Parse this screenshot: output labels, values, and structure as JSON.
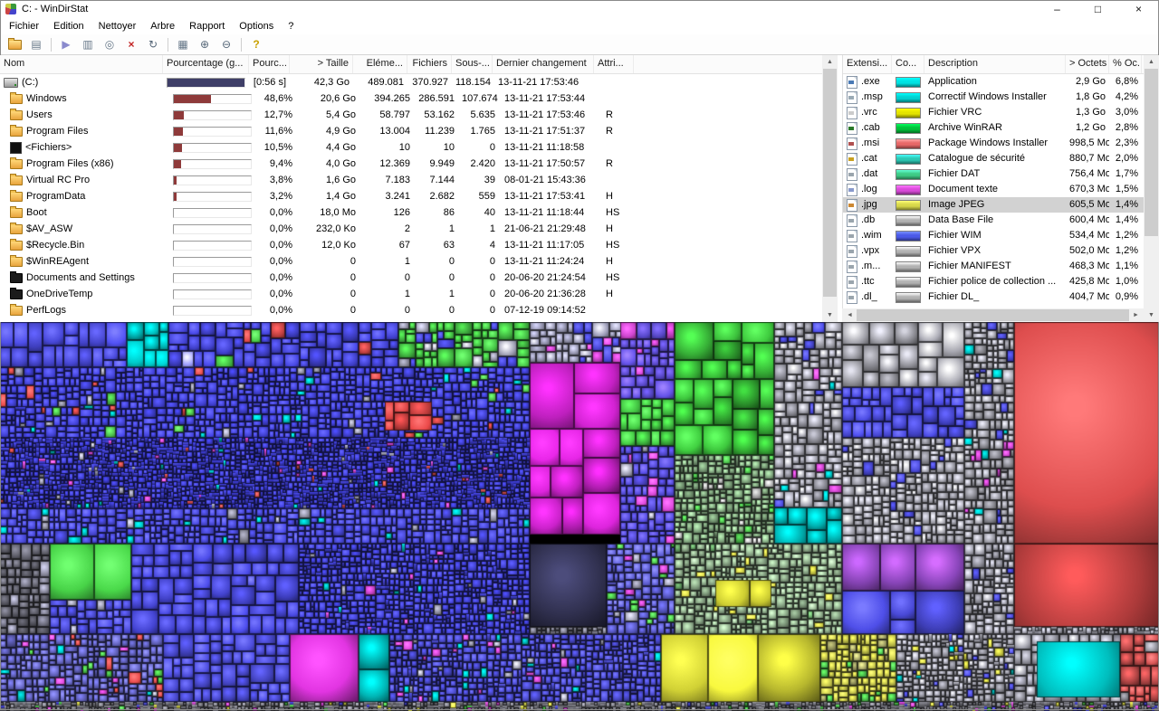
{
  "window": {
    "title": "C: - WinDirStat",
    "controls": [
      {
        "name": "minimize-button",
        "glyph": "–"
      },
      {
        "name": "maximize-button",
        "glyph": "□"
      },
      {
        "name": "close-button",
        "glyph": "×"
      }
    ]
  },
  "menu": {
    "items": [
      "Fichier",
      "Edition",
      "Nettoyer",
      "Arbre",
      "Rapport",
      "Options",
      "?"
    ]
  },
  "toolbar": {
    "buttons": [
      {
        "name": "open-folder-icon",
        "type": "folder"
      },
      {
        "name": "file-tree-icon",
        "glyph": "▤",
        "color": "#667788"
      },
      {
        "sep": true
      },
      {
        "name": "play-icon",
        "glyph": "▶",
        "color": "#8a8acd"
      },
      {
        "name": "copy-icon",
        "glyph": "▥",
        "color": "#667788"
      },
      {
        "name": "zoom-icon",
        "glyph": "◎",
        "color": "#667788"
      },
      {
        "name": "delete-icon",
        "glyph": "×",
        "color": "#c22222"
      },
      {
        "name": "refresh-icon",
        "glyph": "↻",
        "color": "#556677"
      },
      {
        "sep": true
      },
      {
        "name": "report-icon",
        "glyph": "▦",
        "color": "#667788"
      },
      {
        "name": "zoom-in-icon",
        "glyph": "⊕",
        "color": "#556677"
      },
      {
        "name": "zoom-out-icon",
        "glyph": "⊖",
        "color": "#556677"
      },
      {
        "sep": true
      },
      {
        "name": "help-icon",
        "glyph": "?",
        "color": "#c9a100"
      }
    ]
  },
  "tree": {
    "columns": [
      "Nom",
      "Pourcentage (g...",
      "Pourc...",
      "> Taille",
      "Eléme...",
      "Fichiers",
      "Sous-...",
      "Dernier changement",
      "Attri..."
    ],
    "bar_color": "#8e3a3a",
    "rows": [
      {
        "name": "(C:)",
        "icon": "drive",
        "bar": 100,
        "bar_color": "#3f3f68",
        "pct": "[0:56 s]",
        "size": "42,3 Go",
        "items": "489.081",
        "files": "370.927",
        "subdirs": "118.154",
        "changed": "13-11-21 17:53:46",
        "attr": ""
      },
      {
        "name": "Windows",
        "icon": "folder",
        "bar": 48.6,
        "pct": "48,6%",
        "size": "20,6 Go",
        "items": "394.265",
        "files": "286.591",
        "subdirs": "107.674",
        "changed": "13-11-21 17:53:44",
        "attr": ""
      },
      {
        "name": "Users",
        "icon": "folder",
        "bar": 12.7,
        "pct": "12,7%",
        "size": "5,4 Go",
        "items": "58.797",
        "files": "53.162",
        "subdirs": "5.635",
        "changed": "13-11-21 17:53:46",
        "attr": "R"
      },
      {
        "name": "Program Files",
        "icon": "folder",
        "bar": 11.6,
        "pct": "11,6%",
        "size": "4,9 Go",
        "items": "13.004",
        "files": "11.239",
        "subdirs": "1.765",
        "changed": "13-11-21 17:51:37",
        "attr": "R"
      },
      {
        "name": "<Fichiers>",
        "icon": "files",
        "bar": 10.5,
        "pct": "10,5%",
        "size": "4,4 Go",
        "items": "10",
        "files": "10",
        "subdirs": "0",
        "changed": "13-11-21 11:18:58",
        "attr": ""
      },
      {
        "name": "Program Files (x86)",
        "icon": "folder",
        "bar": 9.4,
        "pct": "9,4%",
        "size": "4,0 Go",
        "items": "12.369",
        "files": "9.949",
        "subdirs": "2.420",
        "changed": "13-11-21 17:50:57",
        "attr": "R"
      },
      {
        "name": "Virtual RC Pro",
        "icon": "folder",
        "bar": 3.8,
        "pct": "3,8%",
        "size": "1,6 Go",
        "items": "7.183",
        "files": "7.144",
        "subdirs": "39",
        "changed": "08-01-21 15:43:36",
        "attr": ""
      },
      {
        "name": "ProgramData",
        "icon": "folder",
        "bar": 3.2,
        "pct": "3,2%",
        "size": "1,4 Go",
        "items": "3.241",
        "files": "2.682",
        "subdirs": "559",
        "changed": "13-11-21 17:53:41",
        "attr": "H"
      },
      {
        "name": "Boot",
        "icon": "folder",
        "bar": 0,
        "pct": "0,0%",
        "size": "18,0 Mo",
        "items": "126",
        "files": "86",
        "subdirs": "40",
        "changed": "13-11-21 11:18:44",
        "attr": "HS"
      },
      {
        "name": "$AV_ASW",
        "icon": "folder",
        "bar": 0,
        "pct": "0,0%",
        "size": "232,0 Ko",
        "items": "2",
        "files": "1",
        "subdirs": "1",
        "changed": "21-06-21 21:29:48",
        "attr": "H"
      },
      {
        "name": "$Recycle.Bin",
        "icon": "folder",
        "bar": 0,
        "pct": "0,0%",
        "size": "12,0 Ko",
        "items": "67",
        "files": "63",
        "subdirs": "4",
        "changed": "13-11-21 11:17:05",
        "attr": "HS"
      },
      {
        "name": "$WinREAgent",
        "icon": "folder",
        "bar": 0,
        "pct": "0,0%",
        "size": "0",
        "items": "1",
        "files": "0",
        "subdirs": "0",
        "changed": "13-11-21 11:24:24",
        "attr": "H"
      },
      {
        "name": "Documents and Settings",
        "icon": "folder-dark",
        "bar": 0,
        "pct": "0,0%",
        "size": "0",
        "items": "0",
        "files": "0",
        "subdirs": "0",
        "changed": "20-06-20 21:24:54",
        "attr": "HS"
      },
      {
        "name": "OneDriveTemp",
        "icon": "folder-dark",
        "bar": 0,
        "pct": "0,0%",
        "size": "0",
        "items": "1",
        "files": "1",
        "subdirs": "0",
        "changed": "20-06-20 21:36:28",
        "attr": "H"
      },
      {
        "name": "PerfLogs",
        "icon": "folder",
        "bar": 0,
        "pct": "0,0%",
        "size": "0",
        "items": "0",
        "files": "0",
        "subdirs": "0",
        "changed": "07-12-19 09:14:52",
        "attr": ""
      }
    ]
  },
  "extensions": {
    "columns": [
      "Extensi...",
      "Co...",
      "Description",
      "> Octets",
      "% Oc..."
    ],
    "rows": [
      {
        "ext": ".exe",
        "color": "#00e2e2",
        "icon_accent": "#4a7ab5",
        "desc": "Application",
        "bytes": "2,9 Go",
        "pct": "6,8%"
      },
      {
        "ext": ".msp",
        "color": "#00d2d2",
        "icon_accent": "#9aaab5",
        "desc": "Correctif Windows Installer",
        "bytes": "1,8 Go",
        "pct": "4,2%"
      },
      {
        "ext": ".vrc",
        "color": "#e4e400",
        "icon_accent": "#cccccc",
        "desc": "Fichier VRC",
        "bytes": "1,3 Go",
        "pct": "3,0%"
      },
      {
        "ext": ".cab",
        "color": "#00c23a",
        "icon_accent": "#2a7a2a",
        "desc": "Archive WinRAR",
        "bytes": "1,2 Go",
        "pct": "2,8%"
      },
      {
        "ext": ".msi",
        "color": "#e86868",
        "icon_accent": "#b05050",
        "desc": "Package Windows Installer",
        "bytes": "998,5 Mo",
        "pct": "2,3%"
      },
      {
        "ext": ".cat",
        "color": "#2cc8b4",
        "icon_accent": "#c8a020",
        "desc": "Catalogue de sécurité",
        "bytes": "880,7 Mo",
        "pct": "2,0%"
      },
      {
        "ext": ".dat",
        "color": "#3ecc86",
        "icon_accent": "#9aa5ad",
        "desc": "Fichier DAT",
        "bytes": "756,4 Mo",
        "pct": "1,7%"
      },
      {
        "ext": ".log",
        "color": "#da4ada",
        "icon_accent": "#8899cc",
        "desc": "Document texte",
        "bytes": "670,3 Mo",
        "pct": "1,5%"
      },
      {
        "ext": ".jpg",
        "color": "#d8d84a",
        "icon_accent": "#cc8833",
        "desc": "Image JPEG",
        "bytes": "605,5 Mo",
        "pct": "1,4%",
        "selected": true
      },
      {
        "ext": ".db",
        "color": "#b2b2b2",
        "icon_accent": "#9aa5ad",
        "desc": "Data Base File",
        "bytes": "600,4 Mo",
        "pct": "1,4%"
      },
      {
        "ext": ".wim",
        "color": "#4a5ae8",
        "icon_accent": "#9aa5ad",
        "desc": "Fichier WIM",
        "bytes": "534,4 Mo",
        "pct": "1,2%"
      },
      {
        "ext": ".vpx",
        "color": "#b2b2b2",
        "icon_accent": "#9aa5ad",
        "desc": "Fichier VPX",
        "bytes": "502,0 Mo",
        "pct": "1,2%"
      },
      {
        "ext": ".m...",
        "color": "#b2b2b2",
        "icon_accent": "#9aa5ad",
        "desc": "Fichier MANIFEST",
        "bytes": "468,3 Mo",
        "pct": "1,1%"
      },
      {
        "ext": ".ttc",
        "color": "#b2b2b2",
        "icon_accent": "#9aa5ad",
        "desc": "Fichier police de collection ...",
        "bytes": "425,8 Mo",
        "pct": "1,0%"
      },
      {
        "ext": ".dl_",
        "color": "#b2b2b2",
        "icon_accent": "#9aa5ad",
        "desc": "Fichier DL_",
        "bytes": "404,7 Mo",
        "pct": "0,9%"
      }
    ]
  },
  "treemap": {
    "background": "#000000",
    "region_format": [
      "x",
      "y",
      "w",
      "h",
      "color",
      "grain",
      "accent_colors",
      "accent_probability"
    ],
    "regions": [
      [
        0,
        0,
        140,
        50,
        "#4747d6",
        24,
        [
          "#6a6ae0"
        ],
        0.1
      ],
      [
        140,
        0,
        46,
        50,
        "#00c2c2",
        26,
        [],
        0
      ],
      [
        186,
        0,
        254,
        50,
        "#4040cc",
        18,
        [
          "#cc4444",
          "#44bb44",
          "#8888dd"
        ],
        0.07
      ],
      [
        440,
        0,
        145,
        50,
        "#3fae3f",
        14,
        [
          "#4040cc",
          "#888899"
        ],
        0.3
      ],
      [
        0,
        50,
        585,
        78,
        "#3c3cc8",
        10,
        [
          "#cc4444",
          "#00b8b8",
          "#44aa44",
          "#808090"
        ],
        0.07
      ],
      [
        425,
        88,
        52,
        32,
        "#cc4040",
        26,
        [],
        0
      ],
      [
        0,
        128,
        585,
        78,
        "#3838c2",
        6,
        [
          "#bb4444",
          "#00aaaa",
          "#888899",
          "#cc44cc"
        ],
        0.05
      ],
      [
        0,
        206,
        585,
        39,
        "#4343cc",
        11,
        [
          "#00b0b0",
          "#888899"
        ],
        0.08
      ],
      [
        585,
        0,
        105,
        45,
        "#8888a0",
        13,
        [
          "#4444cc",
          "#cc44cc"
        ],
        0.25
      ],
      [
        585,
        45,
        100,
        190,
        "#cc22cc",
        55,
        [],
        0
      ],
      [
        685,
        0,
        60,
        85,
        "#5a4ad0",
        15,
        [
          "#cc44cc"
        ],
        0.2
      ],
      [
        685,
        85,
        60,
        52,
        "#3fb83f",
        22,
        [],
        0
      ],
      [
        685,
        137,
        60,
        108,
        "#4c44c8",
        12,
        [
          "#cc44cc",
          "#888899"
        ],
        0.15
      ],
      [
        745,
        0,
        110,
        147,
        "#38b438",
        38,
        [
          "#2f9e2f"
        ],
        0.25
      ],
      [
        745,
        147,
        110,
        98,
        "#6f8f6d",
        9,
        [
          "#44aa44",
          "#999999"
        ],
        0.15
      ],
      [
        855,
        0,
        75,
        205,
        "#8f8f99",
        13,
        [
          "#4444cc",
          "#00b0b0",
          "#cc44cc"
        ],
        0.12
      ],
      [
        855,
        205,
        75,
        40,
        "#00b2b2",
        26,
        [],
        0
      ],
      [
        930,
        0,
        135,
        72,
        "#97979f",
        30,
        [],
        0
      ],
      [
        930,
        72,
        135,
        56,
        "#4545cf",
        19,
        [],
        0
      ],
      [
        930,
        128,
        135,
        117,
        "#8d8d96",
        11,
        [
          "#4444cc",
          "#b0b0b8"
        ],
        0.1
      ],
      [
        1065,
        0,
        55,
        245,
        "#87878f",
        11,
        [
          "#4444cc",
          "#cc44cc",
          "#00b0b0"
        ],
        0.12
      ],
      [
        1120,
        0,
        160,
        245,
        "#d24a4a",
        300,
        [],
        0
      ],
      [
        0,
        245,
        55,
        100,
        "#54545e",
        13,
        [
          "#777788"
        ],
        0.2
      ],
      [
        55,
        245,
        90,
        62,
        "#3fb83f",
        70,
        [],
        0
      ],
      [
        55,
        307,
        90,
        38,
        "#4646cc",
        13,
        [
          "#888899"
        ],
        0.12
      ],
      [
        145,
        245,
        185,
        100,
        "#4343ce",
        22,
        [
          "#5555dd"
        ],
        0.1
      ],
      [
        330,
        245,
        255,
        100,
        "#3b3bc2",
        8,
        [
          "#cc44cc",
          "#00b0b0",
          "#888899"
        ],
        0.05
      ],
      [
        585,
        245,
        85,
        92,
        "#3b3b60",
        120,
        [],
        0
      ],
      [
        585,
        337,
        85,
        8,
        "#62626e",
        6,
        [],
        0
      ],
      [
        670,
        245,
        75,
        100,
        "#5353bb",
        11,
        [
          "#cc44cc",
          "#44aa44",
          "#888899"
        ],
        0.15
      ],
      [
        745,
        245,
        185,
        100,
        "#7a9377",
        10,
        [
          "#cccc44",
          "#558855"
        ],
        0.07
      ],
      [
        790,
        285,
        62,
        30,
        "#cece32",
        40,
        [],
        0
      ],
      [
        930,
        245,
        135,
        52,
        "#8a46bb",
        70,
        [],
        0
      ],
      [
        930,
        297,
        135,
        48,
        "#4545cc",
        45,
        [],
        0
      ],
      [
        1065,
        245,
        55,
        100,
        "#8a8a94",
        10,
        [
          "#4444cc"
        ],
        0.1
      ],
      [
        1120,
        245,
        160,
        92,
        "#cc4545",
        200,
        [],
        0
      ],
      [
        1120,
        337,
        160,
        8,
        "#84848e",
        6,
        [],
        0
      ],
      [
        0,
        345,
        180,
        75,
        "#5555a5",
        10,
        [
          "#cc4444",
          "#44aa44",
          "#888899",
          "#00b0b0",
          "#cc44cc"
        ],
        0.15
      ],
      [
        180,
        345,
        140,
        75,
        "#4747cc",
        18,
        [],
        0
      ],
      [
        320,
        345,
        76,
        75,
        "#cc30cc",
        80,
        [],
        0
      ],
      [
        396,
        345,
        34,
        75,
        "#00b6b6",
        28,
        [],
        0
      ],
      [
        430,
        345,
        300,
        75,
        "#4343ba",
        9,
        [
          "#888899",
          "#cc44cc",
          "#00b0b0"
        ],
        0.1
      ],
      [
        730,
        345,
        176,
        75,
        "#d6d636",
        90,
        [],
        0
      ],
      [
        906,
        345,
        84,
        75,
        "#b2b244",
        11,
        [
          "#44aa44",
          "#888855"
        ],
        0.25
      ],
      [
        990,
        345,
        130,
        75,
        "#8a8a94",
        8,
        [
          "#4444cc",
          "#00b0b0",
          "#cccc44"
        ],
        0.12
      ],
      [
        1120,
        345,
        160,
        75,
        "#8f8f99",
        17,
        [
          "#777782"
        ],
        0.2
      ],
      [
        1145,
        353,
        92,
        62,
        "#00bcbc",
        90,
        [],
        0
      ],
      [
        1237,
        345,
        43,
        75,
        "#bb4a4a",
        16,
        [
          "#888890"
        ],
        0.3
      ],
      [
        0,
        420,
        1280,
        10,
        "#6e6e76",
        5,
        [
          "#4444cc",
          "#cc44cc",
          "#44aa44",
          "#cccc44"
        ],
        0.15
      ]
    ]
  }
}
